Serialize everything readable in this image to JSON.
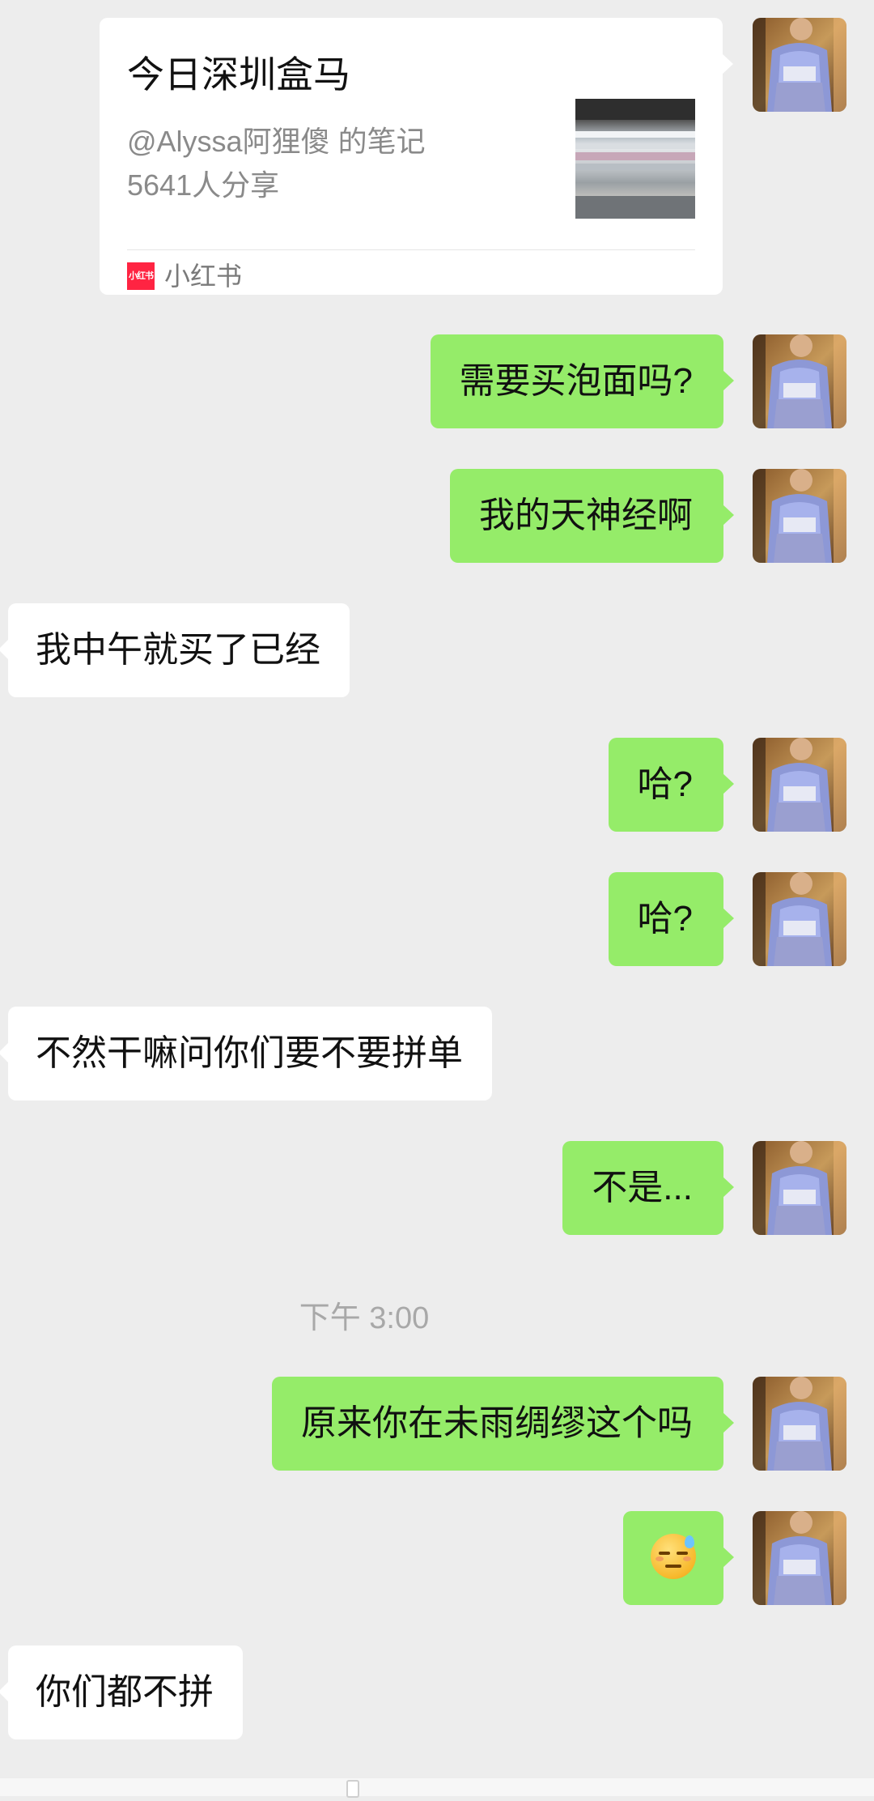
{
  "share_card": {
    "title": "今日深圳盒马",
    "author_line": "@Alyssa阿狸傻 的笔记",
    "share_count": "5641人分享",
    "source_name": "小红书",
    "source_icon_text": "小红书",
    "source_color": "#ff2442"
  },
  "messages": [
    {
      "from": "me",
      "text": "需要买泡面吗?"
    },
    {
      "from": "me",
      "text": "我的天神经啊"
    },
    {
      "from": "them",
      "text": "我中午就买了已经"
    },
    {
      "from": "me",
      "text": "哈?"
    },
    {
      "from": "me",
      "text": "哈?"
    },
    {
      "from": "them",
      "text": "不然干嘛问你们要不要拼单"
    },
    {
      "from": "me",
      "text": "不是..."
    },
    {
      "from": "me",
      "text": "原来你在未雨绸缪这个吗"
    },
    {
      "from": "me",
      "emoji": "downcast-face-with-sweat-emoji"
    },
    {
      "from": "them",
      "text": "你们都不拼"
    }
  ],
  "timestamp": "下午 3:00",
  "colors": {
    "background": "#ededed",
    "my_bubble": "#95ec69",
    "their_bubble": "#ffffff"
  }
}
